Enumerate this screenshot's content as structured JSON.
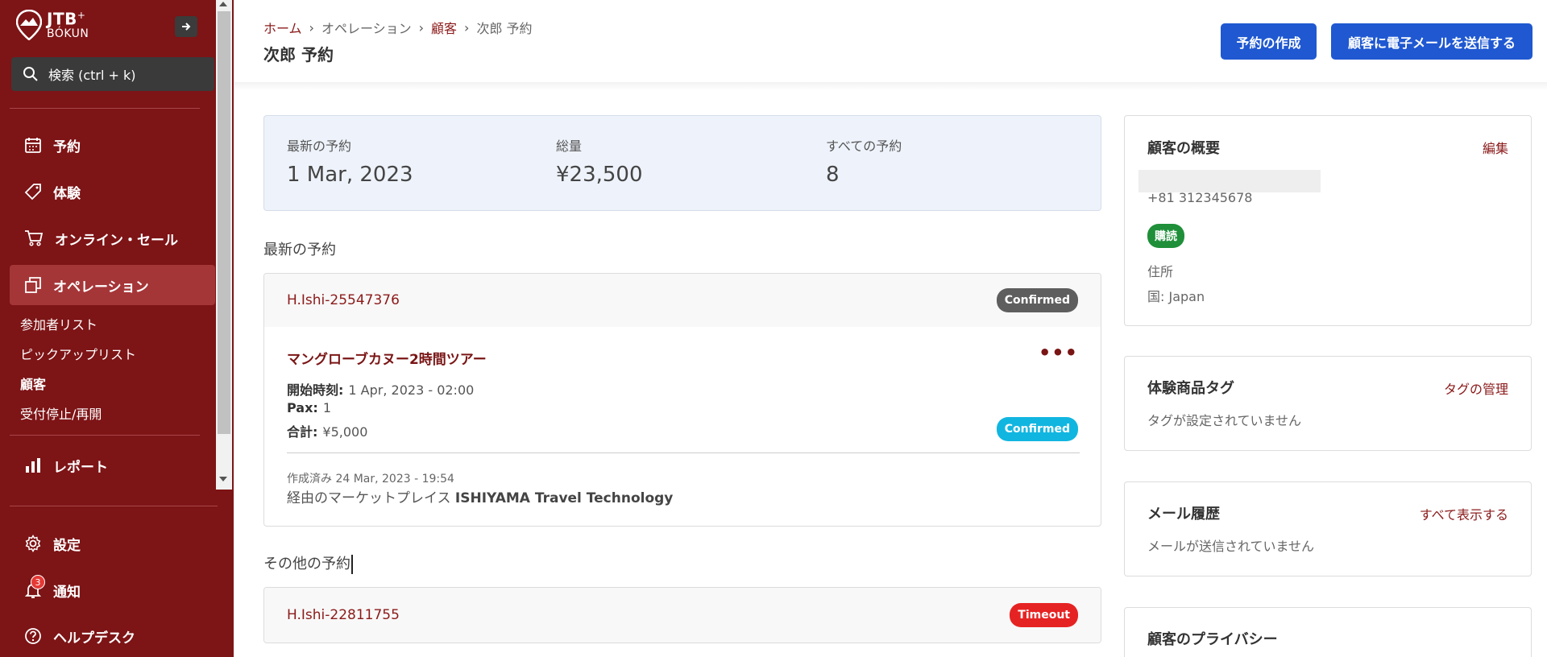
{
  "brand": {
    "line1": "JTB",
    "plus": "+",
    "line2": "BÓKUN"
  },
  "search": {
    "label": "検索 (ctrl + k)"
  },
  "sidebar": {
    "items": [
      {
        "label": "予約"
      },
      {
        "label": "体験"
      },
      {
        "label": "オンライン・セール"
      },
      {
        "label": "オペレーション"
      },
      {
        "label": "レポート"
      },
      {
        "label": "設定"
      },
      {
        "label": "通知"
      },
      {
        "label": "ヘルプデスク"
      }
    ],
    "sub_items": [
      {
        "label": "参加者リスト"
      },
      {
        "label": "ピックアップリスト"
      },
      {
        "label": "顧客"
      },
      {
        "label": "受付停止/再開"
      }
    ],
    "notification_count": "3"
  },
  "breadcrumb": [
    "ホーム",
    "オペレーション",
    "顧客",
    "次郎 予約"
  ],
  "page_title": "次郎 予約",
  "header": {
    "create_booking": "予約の作成",
    "email_customer": "顧客に電子メールを送信する"
  },
  "stats": [
    {
      "label": "最新の予約",
      "value": "1 Mar, 2023"
    },
    {
      "label": "総量",
      "value": "¥23,500"
    },
    {
      "label": "すべての予約",
      "value": "8"
    }
  ],
  "latest_section": "最新の予約",
  "latest_booking": {
    "id": "H.Ishi-25547376",
    "status": "Confirmed",
    "title": "マングローブカヌー2時間ツアー",
    "start_label": "開始時刻:",
    "start_value": "1 Apr, 2023 - 02:00",
    "pax_label": "Pax:",
    "pax_value": "1",
    "total_label": "合計:",
    "total_value": "¥5,000",
    "item_status": "Confirmed",
    "created": "作成済み 24 Mar, 2023 - 19:54",
    "via_label": "経由のマーケットプレイス",
    "via_value": "ISHIYAMA Travel Technology"
  },
  "other_section": "その他の予約",
  "other_booking": {
    "id": "H.Ishi-22811755",
    "status": "Timeout"
  },
  "customer_overview": {
    "title": "顧客の概要",
    "edit": "編集",
    "phone": "+81 312345678",
    "subscribed": "購読",
    "address": "住所",
    "country": "国: Japan"
  },
  "product_tags": {
    "title": "体験商品タグ",
    "manage": "タグの管理",
    "empty": "タグが設定されていません"
  },
  "email_history": {
    "title": "メール履歴",
    "show_all": "すべて表示する",
    "empty": "メールが送信されていません"
  },
  "privacy": {
    "title": "顧客のプライバシー"
  },
  "colors": {
    "sidebar": "#7d1416",
    "primary_button": "#1f58d1",
    "link": "#8b1a1a",
    "confirmed_gray": "#5e5e5e",
    "confirmed_cyan": "#11b6e0",
    "timeout": "#e62323",
    "subscribed": "#1f8f3a"
  }
}
